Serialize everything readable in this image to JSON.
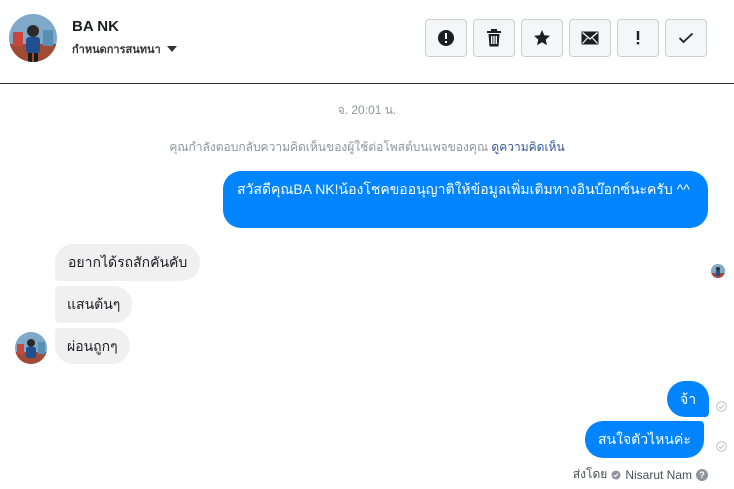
{
  "header": {
    "contact_name": "BA NK",
    "subtitle": "กำหนดการสนทนา"
  },
  "toolbar": [
    {
      "icon": "alert-circle-icon",
      "label": "Mark as spam"
    },
    {
      "icon": "trash-icon",
      "label": "Delete"
    },
    {
      "icon": "star-icon",
      "label": "Star"
    },
    {
      "icon": "envelope-icon",
      "label": "Mark unread"
    },
    {
      "icon": "exclamation-icon",
      "label": "Flag"
    },
    {
      "icon": "checkmark-icon",
      "label": "Done"
    }
  ],
  "thread": {
    "timestamp": "จ. 20:01 น.",
    "notice_text": "คุณกำลังตอบกลับความคิดเห็นของผู้ใช้ต่อโพสต์บนเพจของคุณ",
    "notice_link": "ดูความคิดเห็น",
    "messages": [
      {
        "direction": "outgoing",
        "text": "สวัสดีคุณBA NK!น้องโชคขออนุญาติให้ข้อมูลเพิ่มเติมทางอินบ๊อกซ์นะครับ ^^"
      },
      {
        "direction": "incoming",
        "text": "อยากได้รถสักคันคับ"
      },
      {
        "direction": "incoming",
        "text": "แสนต้นๆ"
      },
      {
        "direction": "incoming",
        "text": "ผ่อนถูกๆ"
      },
      {
        "direction": "outgoing",
        "text": "จ้า"
      },
      {
        "direction": "outgoing",
        "text": "สนใจตัวไหนค่ะ"
      }
    ],
    "sent_by_label": "ส่งโดย",
    "sent_by_name": "Nisarut Nam"
  },
  "colors": {
    "outgoing_bubble": "#0084ff",
    "incoming_bubble": "#f1f0f0",
    "link": "#365899"
  }
}
